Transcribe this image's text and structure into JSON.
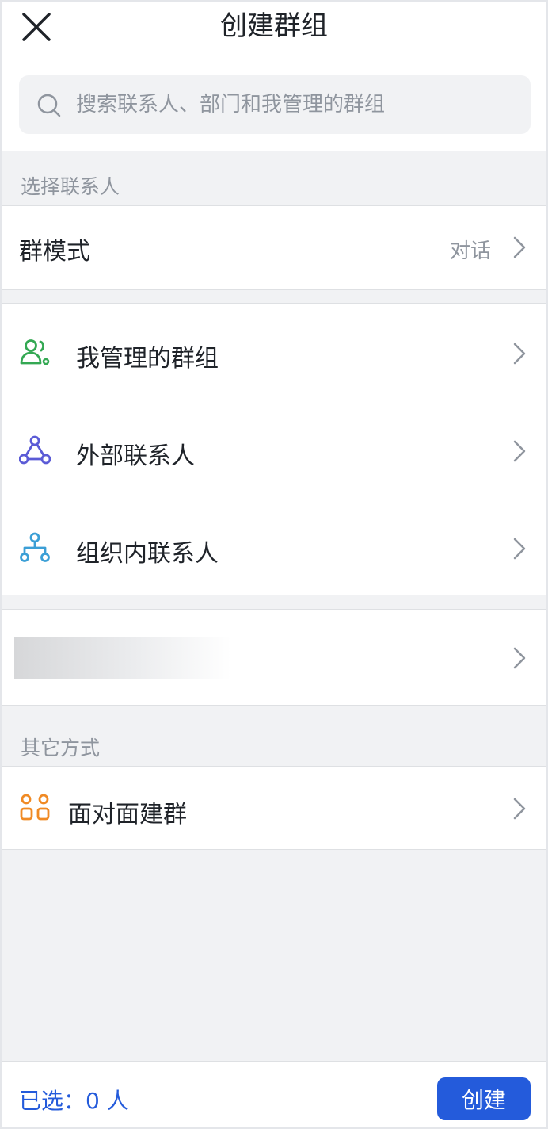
{
  "header": {
    "title": "创建群组",
    "close_icon": "close-icon"
  },
  "search": {
    "placeholder": "搜索联系人、部门和我管理的群组",
    "icon": "search-icon"
  },
  "sections": {
    "select_contacts": "选择联系人",
    "other_ways": "其它方式"
  },
  "group_mode": {
    "label": "群模式",
    "value": "对话"
  },
  "contact_sources": [
    {
      "label": "我管理的群组",
      "icon": "managed-groups-icon",
      "color": "#34a853"
    },
    {
      "label": "外部联系人",
      "icon": "external-contacts-icon",
      "color": "#5b5bd6"
    },
    {
      "label": "组织内联系人",
      "icon": "org-tree-icon",
      "color": "#3b9fd6"
    }
  ],
  "other_methods": [
    {
      "label": "面对面建群",
      "icon": "face-to-face-icon",
      "color": "#f08a24"
    }
  ],
  "footer": {
    "selected_text": "已选：0 人",
    "create_label": "创建"
  },
  "colors": {
    "accent": "#245bdb",
    "background": "#f1f2f4",
    "muted_text": "#8f959e"
  }
}
